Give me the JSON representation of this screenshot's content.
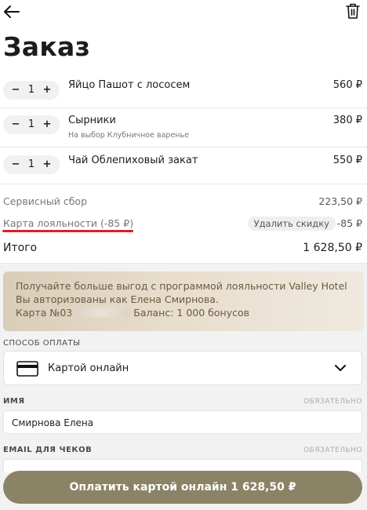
{
  "header": {
    "title": "Заказ",
    "back_icon": "arrow-left-icon",
    "delete_icon": "trash-icon"
  },
  "order_items": [
    {
      "qty": "1",
      "name": "Яйцо Пашот с лососем",
      "option": "",
      "price": "560 ₽"
    },
    {
      "qty": "1",
      "name": "Сырники",
      "option": "На выбор Клубничное варенье",
      "price": "380 ₽"
    },
    {
      "qty": "1",
      "name": "Чай Облепиховый закат",
      "option": "",
      "price": "550 ₽"
    }
  ],
  "stepper": {
    "minus": "−",
    "plus": "+"
  },
  "summary": {
    "service_fee_label": "Сервисный сбор",
    "service_fee_value": "223,50 ₽",
    "loyalty_label": "Карта лояльности (-85 ₽)",
    "remove_discount_label": "Удалить скидку",
    "loyalty_value": "-85 ₽",
    "total_label": "Итого",
    "total_value": "1 628,50 ₽"
  },
  "promo": {
    "line1": "Получайте больше выгод с программой лояльности Valley Hotel",
    "line2": "Вы авторизованы как Елена Смирнова.",
    "card_prefix": "Карта №03",
    "balance": "Баланс: 1 000 бонусов"
  },
  "payment": {
    "section_label": "СПОСОБ ОПЛАТЫ",
    "selected_method": "Картой онлайн",
    "card_icon": "credit-card-icon",
    "chevron_icon": "chevron-down-icon"
  },
  "form": {
    "name_label": "ИМЯ",
    "name_required": "ОБЯЗАТЕЛЬНО",
    "name_value": "Смирнова Елена",
    "email_label": "EMAIL ДЛЯ ЧЕКОВ",
    "email_required": "ОБЯЗАТЕЛЬНО"
  },
  "pay_button_label": "Оплатить картой онлайн 1 628,50 ₽",
  "colors": {
    "accent_button": "#8a8366",
    "promo_text": "#6d5a3d",
    "highlight_red": "#d8202a"
  }
}
